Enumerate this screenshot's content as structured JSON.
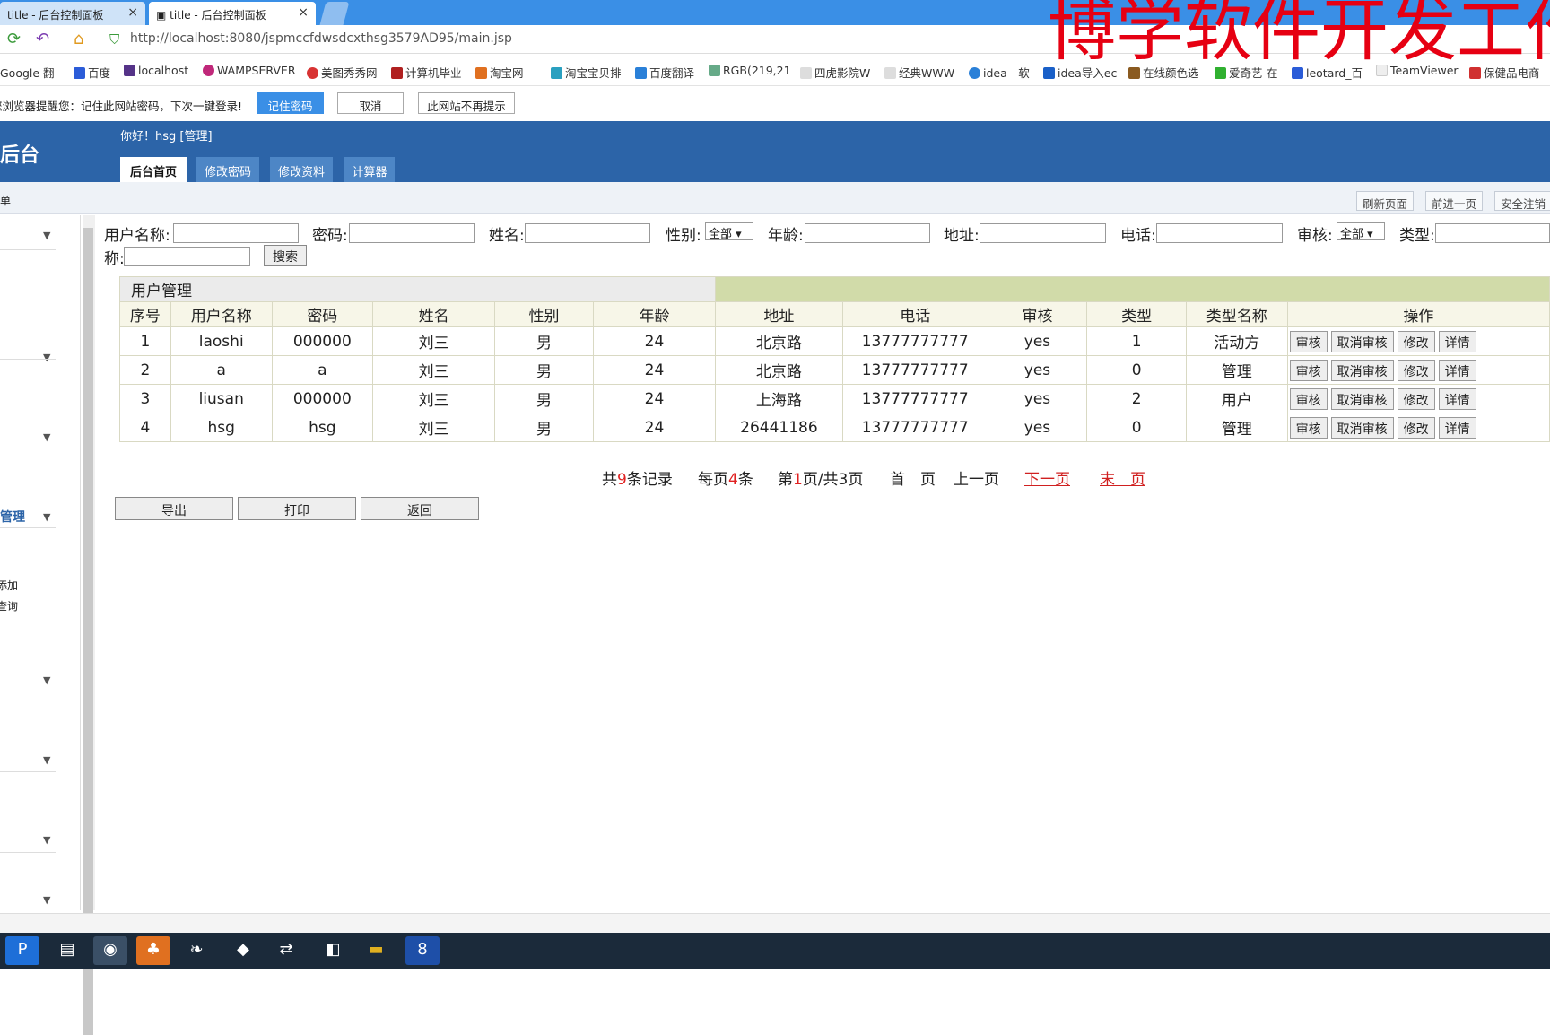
{
  "tabs": [
    {
      "label": "title - 后台控制面板"
    },
    {
      "label": "title - 后台控制面板"
    }
  ],
  "address": {
    "url": "http://localhost:8080/jspmccfdwsdcxthsg3579AD95/main.jsp"
  },
  "bookmarks": [
    "Google 翻",
    "百度",
    "localhost",
    "WAMPSERVER",
    "美图秀秀网",
    "计算机毕业",
    "淘宝网 -",
    "淘宝宝贝排",
    "百度翻译",
    "RGB(219,21",
    "四虎影院W",
    "经典WWW",
    "idea - 软",
    "idea导入ec",
    "在线颜色选",
    "爱奇艺-在",
    "leotard_百",
    "TeamViewer",
    "保健品电商"
  ],
  "pwbar": {
    "text": "您浏览器提醒您：记住此网站密码，下次一键登录!",
    "remember": "记住密码",
    "cancel": "取消",
    "never": "此网站不再提示"
  },
  "header": {
    "brand": "管理后台",
    "greeting": "你好！hsg [管理]",
    "tabs": [
      "后台首页",
      "修改密码",
      "修改资料",
      "计算器"
    ]
  },
  "strip": {
    "refresh": "刷新页面",
    "forward": "前进一页",
    "logout": "安全注销",
    "left": "单"
  },
  "sidebar": {
    "items": [
      "管理",
      "添加",
      "查询"
    ]
  },
  "search": {
    "username": "用户名称:",
    "password": "密码:",
    "name": "姓名:",
    "gender": "性别:",
    "gender_val": "全部",
    "age": "年龄:",
    "address": "地址:",
    "phone": "电话:",
    "audit": "审核:",
    "audit_val": "全部",
    "type": "类型:",
    "typename": "称:",
    "button": "搜索"
  },
  "table": {
    "caption": "用户管理",
    "headers": [
      "序号",
      "用户名称",
      "密码",
      "姓名",
      "性别",
      "年龄",
      "地址",
      "电话",
      "审核",
      "类型",
      "类型名称",
      "操作"
    ],
    "rows": [
      [
        "1",
        "laoshi",
        "000000",
        "刘三",
        "男",
        "24",
        "北京路",
        "13777777777",
        "yes",
        "1",
        "活动方"
      ],
      [
        "2",
        "a",
        "a",
        "刘三",
        "男",
        "24",
        "北京路",
        "13777777777",
        "yes",
        "0",
        "管理"
      ],
      [
        "3",
        "liusan",
        "000000",
        "刘三",
        "男",
        "24",
        "上海路",
        "13777777777",
        "yes",
        "2",
        "用户"
      ],
      [
        "4",
        "hsg",
        "hsg",
        "刘三",
        "男",
        "24",
        "26441186",
        "13777777777",
        "yes",
        "0",
        "管理"
      ]
    ],
    "ops": [
      "审核",
      "取消审核",
      "修改",
      "详情"
    ]
  },
  "pager": {
    "total_pre": "共",
    "total": "9",
    "total_post": "条记录",
    "per_pre": "每页",
    "per": "4",
    "per_post": "条",
    "page_pre": "第",
    "page": "1",
    "page_post": "页/共3页",
    "first": "首　页",
    "prev": "上一页",
    "next": "下一页",
    "last": "末　页"
  },
  "actions": {
    "export": "导出",
    "print": "打印",
    "back": "返回"
  },
  "watermark": "博学软件开发工作"
}
